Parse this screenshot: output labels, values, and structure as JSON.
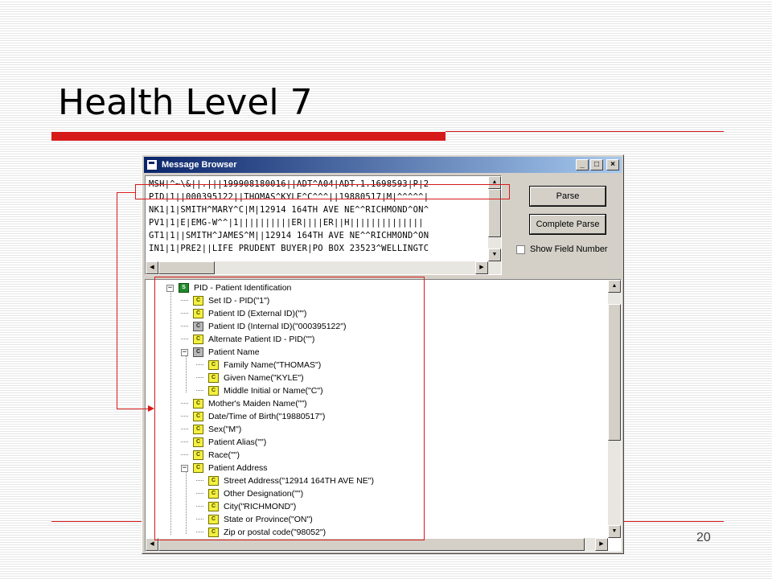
{
  "slide": {
    "title": "Health Level 7",
    "page_number": "20"
  },
  "window": {
    "title": "Message Browser",
    "minimize_glyph": "_",
    "maximize_glyph": "□",
    "close_glyph": "×"
  },
  "raw_message": {
    "lines": [
      "MSH|^~\\&||.|||199908180016||ADT^A04|ADT.1.1698593|P|2",
      "PID|1||000395122||THOMAS^KYLE^C^^^||19880517|M|^^^^^|",
      "NK1|1|SMITH^MARY^C|M|12914 164TH AVE NE^^RICHMOND^ON^",
      "PV1|1|E|EMG-W^^|1||||||||||ER||||ER||H||||||||||||||",
      "GT1|1||SMITH^JAMES^M||12914 164TH AVE NE^^RICHMOND^ON",
      "IN1|1|PRE2||LIFE PRUDENT BUYER|PO BOX 23523^WELLINGTC"
    ]
  },
  "buttons": {
    "parse": "Parse",
    "complete_parse": "Complete Parse"
  },
  "show_field_number": {
    "label": "Show Field Number",
    "checked": false
  },
  "icons": {
    "segment": "S",
    "component": "C",
    "expanded": "−"
  },
  "tree": {
    "root": "PID - Patient Identification",
    "fields": [
      "Set ID - PID(\"1\")",
      "Patient ID (External ID)(\"\")",
      "Patient ID (Internal ID)(\"000395122\")",
      "Alternate Patient ID - PID(\"\")",
      "Patient Name",
      "Family Name(\"THOMAS\")",
      "Given Name(\"KYLE\")",
      "Middle Initial or Name(\"C\")",
      "Mother's Maiden Name(\"\")",
      "Date/Time of Birth(\"19880517\")",
      "Sex(\"M\")",
      "Patient Alias(\"\")",
      "Race(\"\")",
      "Patient Address",
      "Street Address(\"12914 164TH AVE NE\")",
      "Other Designation(\"\")",
      "City(\"RICHMOND\")",
      "State or Province(\"ON\")",
      "Zip or postal code(\"98052\")"
    ]
  },
  "colors": {
    "accent_red": "#d61a1a",
    "titlebar_start": "#0a246a",
    "window_face": "#d4d0c8"
  }
}
